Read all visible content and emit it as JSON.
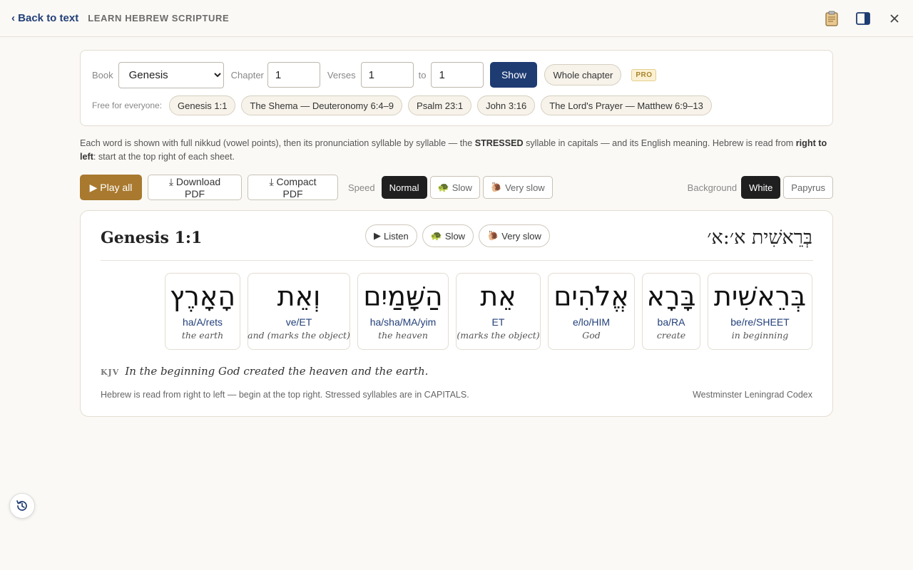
{
  "topbar": {
    "back_label": "‹ Back to text",
    "app_title": "LEARN HEBREW SCRIPTURE",
    "icons": [
      "clipboard-icon",
      "sidebar-toggle-icon",
      "close-icon"
    ]
  },
  "selector": {
    "book_label": "Book",
    "book_value": "Genesis",
    "chapter_label": "Chapter",
    "chapter_value": "1",
    "verses_label": "Verses",
    "verse_from": "1",
    "to_label": "to",
    "verse_to": "1",
    "show_label": "Show",
    "whole_chapter_label": "Whole chapter",
    "pro_badge": "PRO",
    "free_label": "Free for everyone:",
    "presets": [
      "Genesis 1:1",
      "The Shema — Deuteronomy 6:4–9",
      "Psalm 23:1",
      "John 3:16",
      "The Lord's Prayer — Matthew 6:9–13"
    ]
  },
  "intro": {
    "part1": "Each word is shown with full nikkud (vowel points), then its pronunciation syllable by syllable — the ",
    "stressed": "STRESSED",
    "part2": " syllable in capitals — and its English meaning. Hebrew is read from ",
    "rtl": "right to left",
    "part3": ": start at the top right of each sheet."
  },
  "controls": {
    "play_all": "▶ Play all",
    "download_pdf": "Download PDF",
    "compact_pdf": "Compact PDF",
    "speed_label": "Speed",
    "speed_normal": "Normal",
    "speed_slow": "Slow",
    "speed_very_slow": "Very slow",
    "background_label": "Background",
    "bg_white": "White",
    "bg_papyrus": "Papyrus",
    "active_speed": "Normal",
    "active_background": "White"
  },
  "sheet": {
    "title": "Genesis 1:1",
    "listen": "Listen",
    "slow": "Slow",
    "very_slow": "Very slow",
    "hebrew_ref": "בְּרֵאשִׁית א׳:א׳",
    "words": [
      {
        "hebrew": "בְּרֵאשִׁית",
        "pron": "be/re/SHEET",
        "meaning": "in beginning"
      },
      {
        "hebrew": "בָּרָא",
        "pron": "ba/RA",
        "meaning": "create"
      },
      {
        "hebrew": "אֱלֹהִים",
        "pron": "e/lo/HIM",
        "meaning": "God"
      },
      {
        "hebrew": "אֵת",
        "pron": "ET",
        "meaning": "(marks the object)"
      },
      {
        "hebrew": "הַשָּׁמַיִם",
        "pron": "ha/sha/MA/yim",
        "meaning": "the heaven"
      },
      {
        "hebrew": "וְאֵת",
        "pron": "ve/ET",
        "meaning": "and (marks the object)"
      },
      {
        "hebrew": "הָאָרֶץ",
        "pron": "ha/A/rets",
        "meaning": "the earth"
      }
    ],
    "kjv_label": "KJV",
    "kjv_text": "In the beginning God created the heaven and the earth.",
    "footer_note": "Hebrew is read from right to left — begin at the top right. Stressed syllables are in CAPITALS.",
    "source": "Westminster Leningrad Codex"
  },
  "colors": {
    "accent_navy": "#1e3b72",
    "accent_gold": "#a8792e",
    "pron_blue": "#23407a"
  }
}
